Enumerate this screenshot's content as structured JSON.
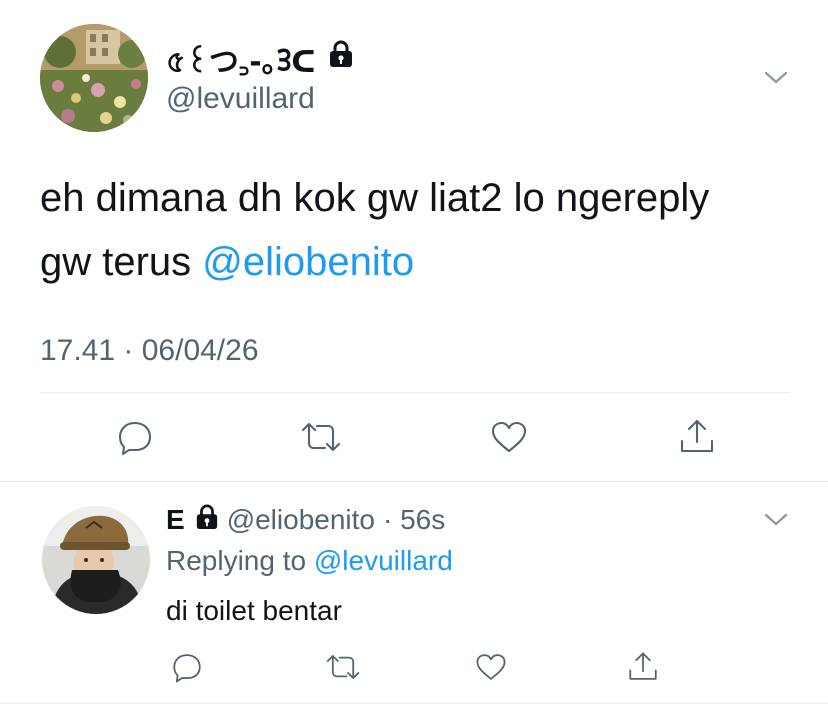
{
  "tweet": {
    "display_name": "৫꒰つ꜆-｡ᢃᑕ",
    "handle": "@levuillard",
    "text_line1": "eh dimana dh kok gw liat2 lo ngereply",
    "text_line2_prefix": "gw terus ",
    "mention": "@eliobenito",
    "timestamp": "17.41 · 06/04/26",
    "locked": true
  },
  "reply": {
    "display_name": "E",
    "handle": "@eliobenito",
    "time": "· 56s",
    "replying_label": "Replying to ",
    "replying_to": "@levuillard",
    "text": "di toilet bentar",
    "locked": true
  },
  "icons": {
    "reply": "reply-icon",
    "retweet": "retweet-icon",
    "like": "like-icon",
    "share": "share-icon",
    "more": "chevron-down-icon",
    "lock": "lock-icon"
  },
  "colors": {
    "text": "#0f1419",
    "secondary": "#536471",
    "link": "#1d9bf0",
    "divider": "#e6ecf0"
  }
}
